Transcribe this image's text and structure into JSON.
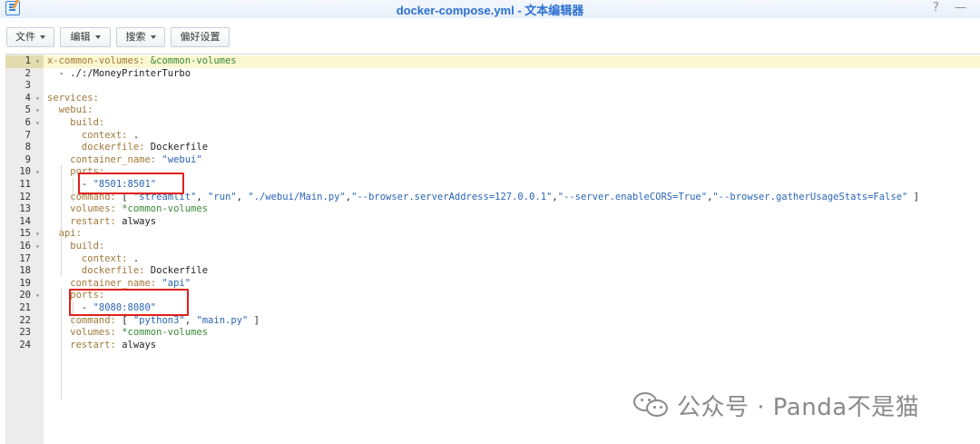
{
  "window": {
    "title": "docker-compose.yml - 文本编辑器",
    "help_glyph": "?",
    "minimize_glyph": "—"
  },
  "toolbar": {
    "file_label": "文件",
    "edit_label": "编辑",
    "search_label": "搜索",
    "prefs_label": "偏好设置"
  },
  "editor": {
    "active_line": 1,
    "lines": [
      {
        "n": "1",
        "fold": "▾",
        "segs": [
          {
            "t": "x-common-volumes: ",
            "c": "k"
          },
          {
            "t": "&common-volumes",
            "c": "a"
          }
        ]
      },
      {
        "n": "2",
        "fold": "",
        "segs": [
          {
            "t": "  - ./:/MoneyPrinterTurbo",
            "c": "p"
          }
        ]
      },
      {
        "n": "3",
        "fold": "",
        "segs": []
      },
      {
        "n": "4",
        "fold": "▾",
        "segs": [
          {
            "t": "services:",
            "c": "k"
          }
        ]
      },
      {
        "n": "5",
        "fold": "▾",
        "segs": [
          {
            "t": "  webui:",
            "c": "k"
          }
        ]
      },
      {
        "n": "6",
        "fold": "▾",
        "segs": [
          {
            "t": "    build:",
            "c": "k"
          }
        ]
      },
      {
        "n": "7",
        "fold": "",
        "segs": [
          {
            "t": "      context: ",
            "c": "k"
          },
          {
            "t": ".",
            "c": "p"
          }
        ]
      },
      {
        "n": "8",
        "fold": "",
        "segs": [
          {
            "t": "      dockerfile: ",
            "c": "k"
          },
          {
            "t": "Dockerfile",
            "c": "p"
          }
        ]
      },
      {
        "n": "9",
        "fold": "",
        "segs": [
          {
            "t": "    container_name: ",
            "c": "k"
          },
          {
            "t": "\"webui\"",
            "c": "s"
          }
        ]
      },
      {
        "n": "10",
        "fold": "▾",
        "segs": [
          {
            "t": "    ports:",
            "c": "k"
          }
        ]
      },
      {
        "n": "11",
        "fold": "",
        "segs": [
          {
            "t": "      - ",
            "c": "p"
          },
          {
            "t": "\"8501:8501\"",
            "c": "s"
          }
        ]
      },
      {
        "n": "12",
        "fold": "",
        "segs": [
          {
            "t": "    command: ",
            "c": "k"
          },
          {
            "t": "[ ",
            "c": "p"
          },
          {
            "t": "\"streamlit\"",
            "c": "s"
          },
          {
            "t": ", ",
            "c": "p"
          },
          {
            "t": "\"run\"",
            "c": "s"
          },
          {
            "t": ", ",
            "c": "p"
          },
          {
            "t": "\"./webui/Main.py\"",
            "c": "s"
          },
          {
            "t": ",",
            "c": "p"
          },
          {
            "t": "\"--browser.serverAddress=127.0.0.1\"",
            "c": "s"
          },
          {
            "t": ",",
            "c": "p"
          },
          {
            "t": "\"--server.enableCORS=True\"",
            "c": "s"
          },
          {
            "t": ",",
            "c": "p"
          },
          {
            "t": "\"--browser.gatherUsageStats=False\"",
            "c": "s"
          },
          {
            "t": " ]",
            "c": "p"
          }
        ]
      },
      {
        "n": "13",
        "fold": "",
        "segs": [
          {
            "t": "    volumes: ",
            "c": "k"
          },
          {
            "t": "*common-volumes",
            "c": "a"
          }
        ]
      },
      {
        "n": "14",
        "fold": "",
        "segs": [
          {
            "t": "    restart: ",
            "c": "k"
          },
          {
            "t": "always",
            "c": "p"
          }
        ]
      },
      {
        "n": "15",
        "fold": "▾",
        "segs": [
          {
            "t": "  api:",
            "c": "k"
          }
        ]
      },
      {
        "n": "16",
        "fold": "▾",
        "segs": [
          {
            "t": "    build:",
            "c": "k"
          }
        ]
      },
      {
        "n": "17",
        "fold": "",
        "segs": [
          {
            "t": "      context: ",
            "c": "k"
          },
          {
            "t": ".",
            "c": "p"
          }
        ]
      },
      {
        "n": "18",
        "fold": "",
        "segs": [
          {
            "t": "      dockerfile: ",
            "c": "k"
          },
          {
            "t": "Dockerfile",
            "c": "p"
          }
        ]
      },
      {
        "n": "19",
        "fold": "",
        "segs": [
          {
            "t": "    container_name: ",
            "c": "k"
          },
          {
            "t": "\"api\"",
            "c": "s"
          }
        ]
      },
      {
        "n": "20",
        "fold": "▾",
        "segs": [
          {
            "t": "    ports:",
            "c": "k"
          }
        ]
      },
      {
        "n": "21",
        "fold": "",
        "segs": [
          {
            "t": "      - ",
            "c": "p"
          },
          {
            "t": "\"8080:8080\"",
            "c": "s"
          }
        ]
      },
      {
        "n": "22",
        "fold": "",
        "segs": [
          {
            "t": "    command: ",
            "c": "k"
          },
          {
            "t": "[ ",
            "c": "p"
          },
          {
            "t": "\"python3\"",
            "c": "s"
          },
          {
            "t": ", ",
            "c": "p"
          },
          {
            "t": "\"main.py\"",
            "c": "s"
          },
          {
            "t": " ]",
            "c": "p"
          }
        ]
      },
      {
        "n": "23",
        "fold": "",
        "segs": [
          {
            "t": "    volumes: ",
            "c": "k"
          },
          {
            "t": "*common-volumes",
            "c": "a"
          }
        ]
      },
      {
        "n": "24",
        "fold": "",
        "segs": [
          {
            "t": "    restart: ",
            "c": "k"
          },
          {
            "t": "always",
            "c": "p"
          }
        ]
      }
    ]
  },
  "watermark": {
    "text": "公众号 · Panda不是猫",
    "icon": "wechat-icon"
  },
  "colors": {
    "title": "#2c6fd1",
    "highlight_box": "#e0201a",
    "key": "#a0783a",
    "string": "#2a64b4",
    "anchor": "#3a8a3a"
  }
}
